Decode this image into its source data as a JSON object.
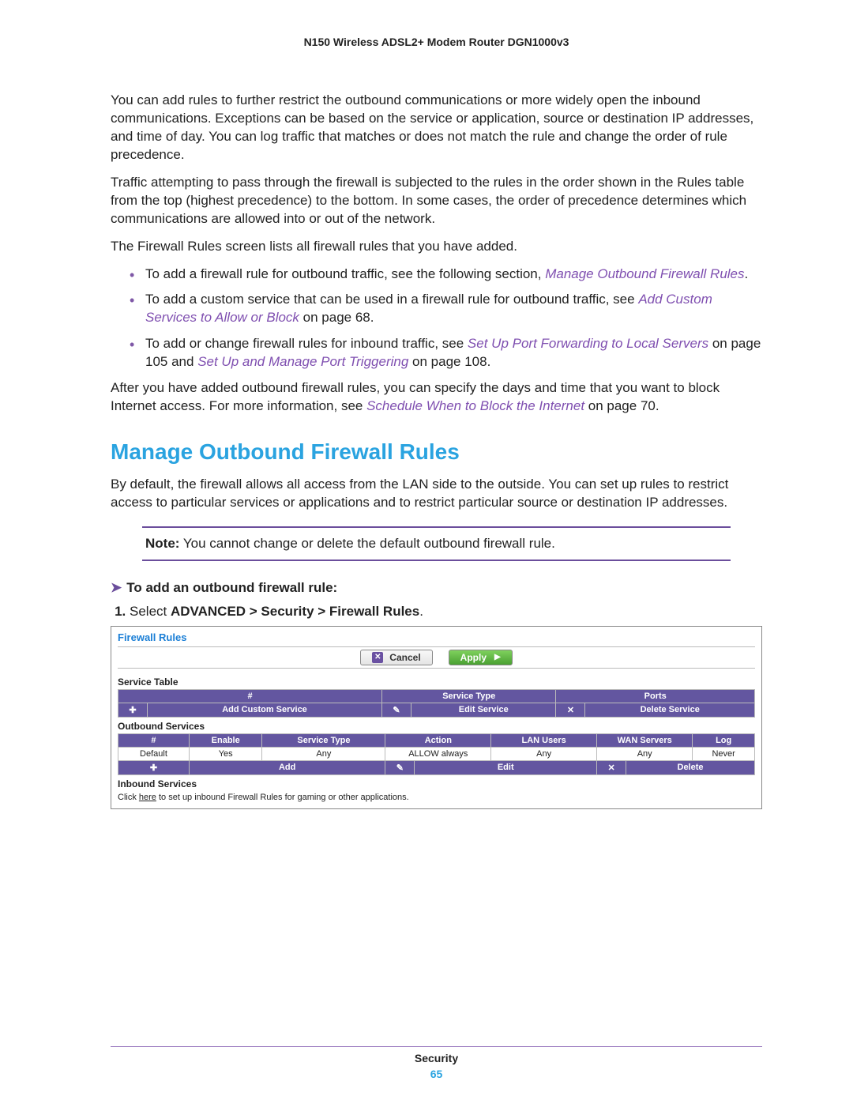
{
  "doc_title": "N150 Wireless ADSL2+ Modem Router DGN1000v3",
  "para1": "You can add rules to further restrict the outbound communications or more widely open the inbound communications. Exceptions can be based on the service or application, source or destination IP addresses, and time of day. You can log traffic that matches or does not match the rule and change the order of rule precedence.",
  "para2": "Traffic attempting to pass through the firewall is subjected to the rules in the order shown in the Rules table from the top (highest precedence) to the bottom. In some cases, the order of precedence determines which communications are allowed into or out of the network.",
  "para3": "The Firewall Rules screen lists all firewall rules that you have added.",
  "bullets": {
    "b1_pre": "To add a firewall rule for outbound traffic, see the following section, ",
    "b1_link": "Manage Outbound Firewall Rules",
    "b1_post": ".",
    "b2_pre": "To add a custom service that can be used in a firewall rule for outbound traffic, see ",
    "b2_link": "Add Custom Services to Allow or Block",
    "b2_post": " on page 68.",
    "b3_pre": "To add or change firewall rules for inbound traffic, see ",
    "b3_link1": "Set Up Port Forwarding to Local Servers",
    "b3_mid": " on page 105 and ",
    "b3_link2": "Set Up and Manage Port Triggering",
    "b3_post": " on page 108."
  },
  "para4_pre": "After you have added outbound firewall rules, you can specify the days and time that you want to block Internet access. For more information, see ",
  "para4_link": "Schedule When to Block the Internet",
  "para4_post": " on page 70.",
  "section_heading": "Manage Outbound Firewall Rules",
  "para5": "By default, the firewall allows all access from the LAN side to the outside. You can set up rules to restrict access to particular services or applications and to restrict particular source or destination IP addresses.",
  "note_label": "Note:",
  "note_text": " You cannot change or delete the default outbound firewall rule.",
  "proc_heading": "To add an outbound firewall rule:",
  "step1_pre": "Select ",
  "step1_bold": "ADVANCED > Security > Firewall Rules",
  "step1_post": ".",
  "ui": {
    "title": "Firewall Rules",
    "cancel": "Cancel",
    "apply": "Apply",
    "service_table": "Service Table",
    "st_cols": [
      "#",
      "Service Type",
      "Ports"
    ],
    "st_actions": [
      "Add Custom Service",
      "Edit Service",
      "Delete Service"
    ],
    "outbound_label": "Outbound Services",
    "out_cols": [
      "#",
      "Enable",
      "Service Type",
      "Action",
      "LAN Users",
      "WAN Servers",
      "Log"
    ],
    "out_row": [
      "Default",
      "Yes",
      "Any",
      "ALLOW always",
      "Any",
      "Any",
      "Never"
    ],
    "out_actions": [
      "Add",
      "Edit",
      "Delete"
    ],
    "inbound_label": "Inbound Services",
    "inbound_note_pre": "Click ",
    "inbound_note_link": "here",
    "inbound_note_post": " to set up inbound Firewall Rules for gaming or other applications."
  },
  "footer_section": "Security",
  "footer_page": "65"
}
